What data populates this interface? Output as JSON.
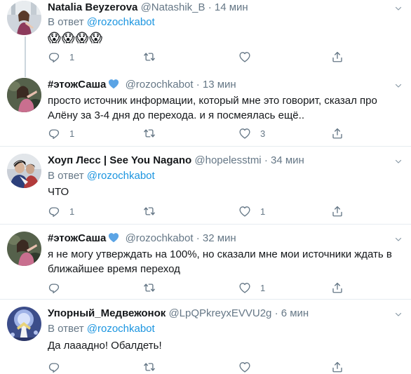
{
  "reply_prefix": "В ответ",
  "tweets": [
    {
      "name": "Natalia Beyzerova",
      "handle": "@Natashik_B",
      "time": "14 мин",
      "reply_to": "@rozochkabot",
      "text": "😱😱😱😱",
      "replies": "1",
      "retweets": "",
      "likes": ""
    },
    {
      "name": "#этожСаша",
      "handle": "@rozochkabot",
      "time": "13 мин",
      "text": "просто источник информации, который мне это говорит, сказал про Алёну за 3-4 дня до перехода. и я посмеялась ещё..",
      "replies": "1",
      "retweets": "",
      "likes": "3"
    },
    {
      "name": "Хоуп Лесс | See You Nagano",
      "handle": "@hopelesstmi",
      "time": "34 мин",
      "reply_to": "@rozochkabot",
      "text": "ЧТО",
      "replies": "1",
      "retweets": "",
      "likes": "1"
    },
    {
      "name": "#этожСаша",
      "handle": "@rozochkabot",
      "time": "32 мин",
      "text": "я не могу утверждать на 100%, но сказали мне мои источники ждать в ближайшее время переход",
      "replies": "",
      "retweets": "",
      "likes": "1"
    },
    {
      "name": "Упорный_Медвежонок",
      "handle": "@LpQPkreyxEVVU2g",
      "time": "6 мин",
      "reply_to": "@rozochkabot",
      "text": "Да лааадно! Обалдеть!",
      "replies": "",
      "retweets": "",
      "likes": ""
    }
  ],
  "colors": {
    "accent": "#1b95e0",
    "muted": "#657786",
    "divider": "#e6ecf0",
    "verified_heart": "#5ba4e5"
  }
}
